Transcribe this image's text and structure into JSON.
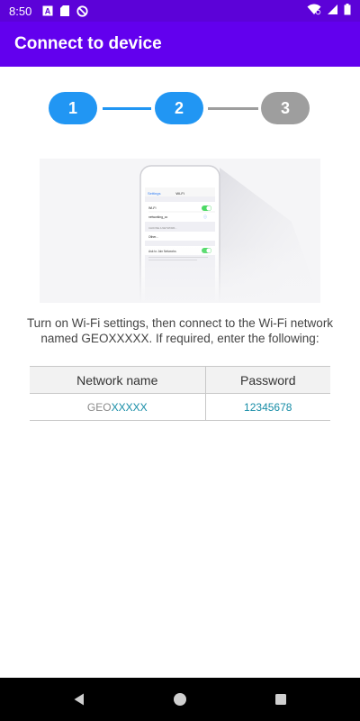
{
  "status_bar": {
    "time": "8:50",
    "left_icons": [
      "a-text-icon",
      "sd-card-icon",
      "no-sync-icon"
    ],
    "right_icons": [
      "wifi-icon",
      "signal-icon",
      "battery-icon"
    ]
  },
  "app_bar": {
    "title": "Connect to device"
  },
  "stepper": {
    "steps": [
      {
        "label": "1",
        "state": "active"
      },
      {
        "label": "2",
        "state": "active"
      },
      {
        "label": "3",
        "state": "inactive"
      }
    ],
    "colors": {
      "active": "#2196f3",
      "inactive": "#9e9e9e"
    }
  },
  "illustration": {
    "description_icon": "phone-wifi-settings-icon",
    "phone": {
      "back_label": "Settings",
      "screen_title": "Wi-Fi",
      "wifi_row": "Wi-Fi",
      "network_row": "networking_co",
      "choose_header": "CHOOSE A NETWORK...",
      "other_row": "Other...",
      "ask_row": "Ask to Join Networks"
    }
  },
  "instruction": "Turn on Wi-Fi settings, then connect to the Wi-Fi network named GEOXXXXX. If required, enter the following:",
  "table": {
    "headers": {
      "network": "Network name",
      "password": "Password"
    },
    "network_prefix": "GEO",
    "network_suffix": "XXXXX",
    "password": "12345678"
  },
  "colors": {
    "status_bar": "#5c02d8",
    "app_bar": "#6200ee",
    "link_text": "#168ca6"
  },
  "nav_bar": {
    "buttons": [
      "back-icon",
      "home-icon",
      "recents-icon"
    ]
  }
}
